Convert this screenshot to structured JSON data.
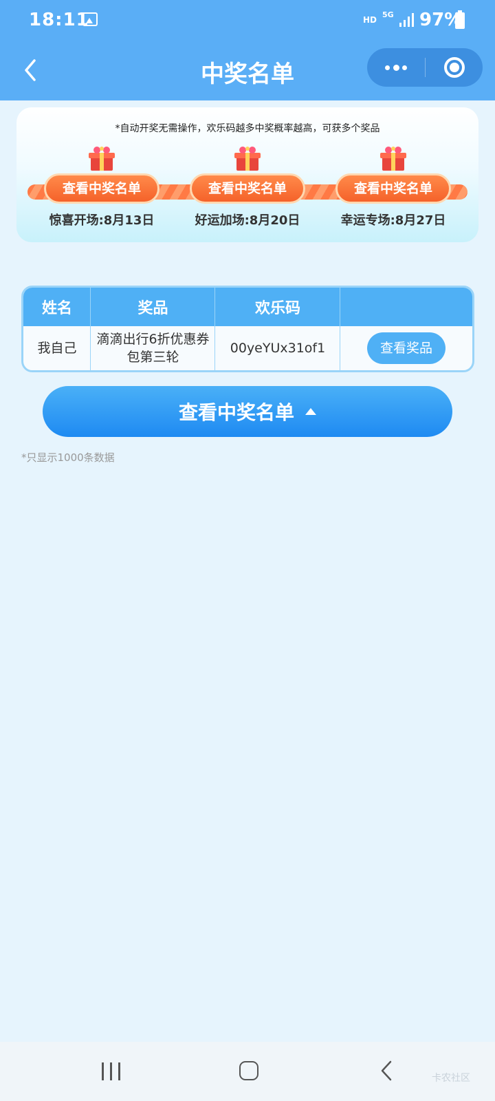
{
  "status_bar": {
    "time": "18:11",
    "network_hd": "HD",
    "network_type": "5G",
    "battery_percent": "97%"
  },
  "nav": {
    "title": "中奖名单",
    "icons": [
      "back-arrow-icon",
      "more-dots-icon",
      "target-icon"
    ]
  },
  "banner": {
    "notice": "*自动开奖无需操作，欢乐码越多中奖概率越高，可获多个奖品",
    "rounds": [
      {
        "button_label": "查看中奖名单",
        "label": "惊喜开场:8月13日"
      },
      {
        "button_label": "查看中奖名单",
        "label": "好运加场:8月20日"
      },
      {
        "button_label": "查看中奖名单",
        "label": "幸运专场:8月27日"
      }
    ],
    "colors": {
      "track": "#ff7a45",
      "pill": "#f5622a"
    }
  },
  "table": {
    "headers": [
      "姓名",
      "奖品",
      "欢乐码",
      ""
    ],
    "rows": [
      {
        "name": "我自己",
        "prize": "滴滴出行6折优惠券包第三轮",
        "code": "00yeYUx31of1",
        "action": "查看奖品"
      }
    ]
  },
  "main_button": {
    "label": "查看中奖名单"
  },
  "footnote": "*只显示1000条数据",
  "system_nav": {
    "watermark": "卡农社区"
  },
  "colors": {
    "primary": "#5aaef6",
    "table_header": "#4fb0f5",
    "background": "#e6f4fd"
  }
}
